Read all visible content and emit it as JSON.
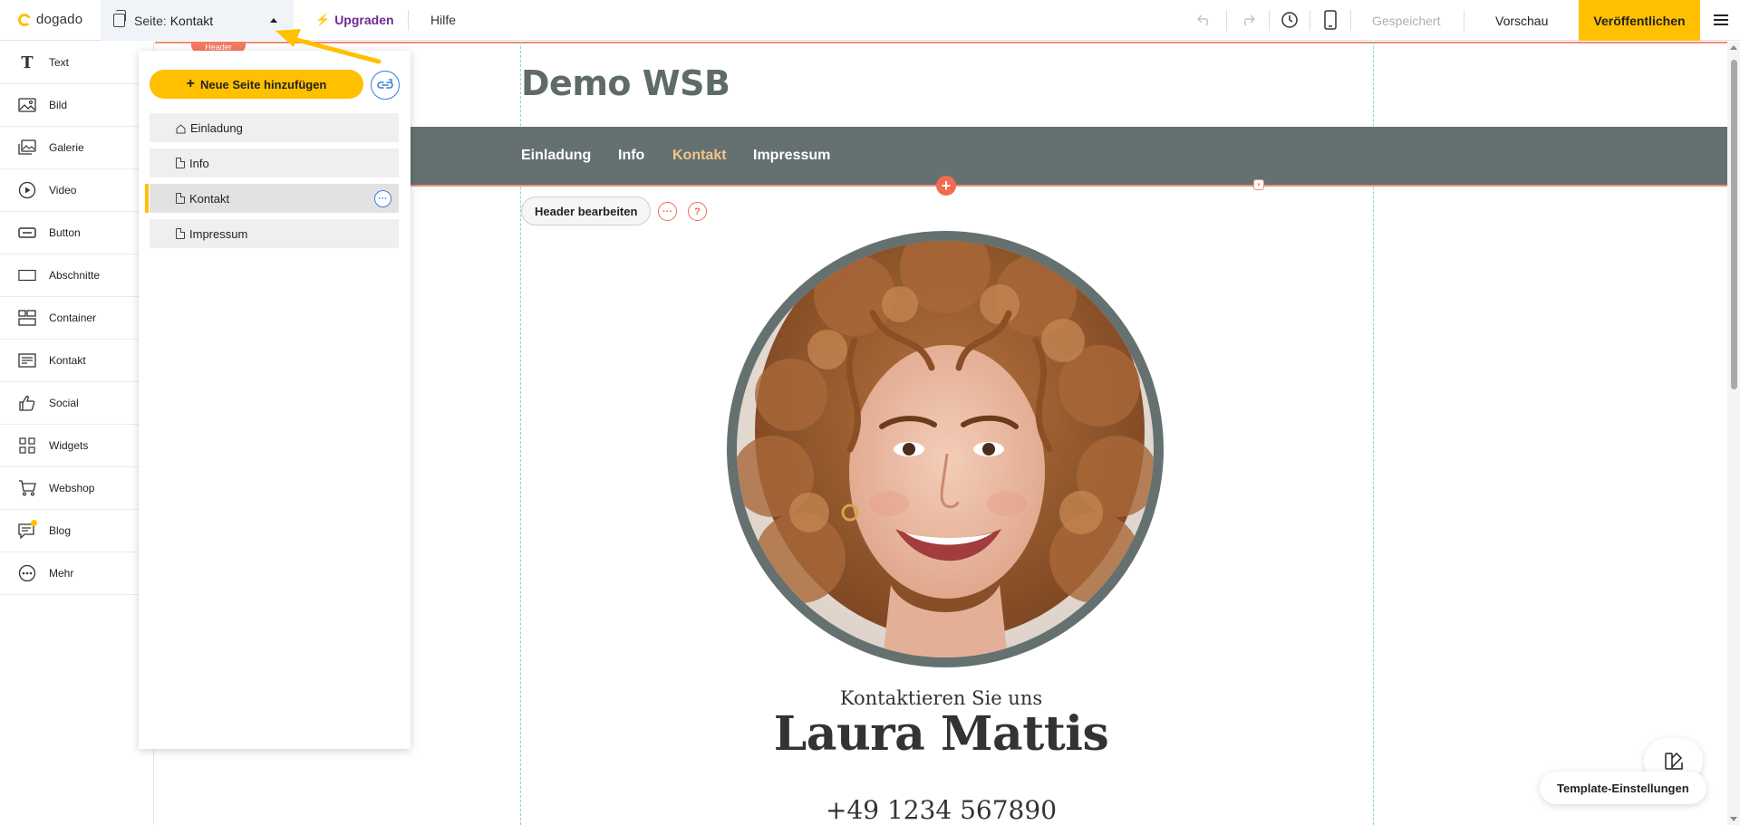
{
  "topbar": {
    "logo_text": "dogado",
    "page_select_prefix": "Seite:",
    "page_select_value": "Kontakt",
    "upgrade_label": "Upgraden",
    "help_label": "Hilfe",
    "saved_label": "Gespeichert",
    "preview_label": "Vorschau",
    "publish_label": "Veröffentlichen",
    "accent_color": "#ffc000",
    "upgrade_color": "#6b2c8f"
  },
  "sidebar": {
    "items": [
      {
        "label": "Text",
        "icon": "text-icon"
      },
      {
        "label": "Bild",
        "icon": "image-icon"
      },
      {
        "label": "Galerie",
        "icon": "gallery-icon"
      },
      {
        "label": "Video",
        "icon": "video-icon"
      },
      {
        "label": "Button",
        "icon": "button-icon"
      },
      {
        "label": "Abschnitte",
        "icon": "section-icon"
      },
      {
        "label": "Container",
        "icon": "container-icon"
      },
      {
        "label": "Kontakt",
        "icon": "contact-form-icon"
      },
      {
        "label": "Social",
        "icon": "thumbs-up-icon"
      },
      {
        "label": "Widgets",
        "icon": "widgets-icon"
      },
      {
        "label": "Webshop",
        "icon": "cart-icon"
      },
      {
        "label": "Blog",
        "icon": "blog-icon"
      },
      {
        "label": "Mehr",
        "icon": "more-icon"
      }
    ]
  },
  "pages_panel": {
    "add_page_label": "Neue Seite hinzufügen",
    "pages": [
      {
        "label": "Einladung",
        "icon": "home-icon",
        "current": false
      },
      {
        "label": "Info",
        "icon": "page-icon",
        "current": false
      },
      {
        "label": "Kontakt",
        "icon": "page-icon",
        "current": true
      },
      {
        "label": "Impressum",
        "icon": "page-icon",
        "current": false
      }
    ]
  },
  "site": {
    "header_tag": "Header",
    "title": "Demo WSB",
    "nav": [
      "Einladung",
      "Info",
      "Kontakt",
      "Impressum"
    ],
    "nav_active": "Kontakt",
    "header_edit_label": "Header bearbeiten",
    "contact_sub": "Kontaktieren Sie uns",
    "contact_name": "Laura Mattis",
    "contact_phone": "+49 1234 567890",
    "nav_color": "#647170",
    "highlight_color": "#f26b4f"
  },
  "floating": {
    "template_settings_label": "Template-Einstellungen"
  }
}
